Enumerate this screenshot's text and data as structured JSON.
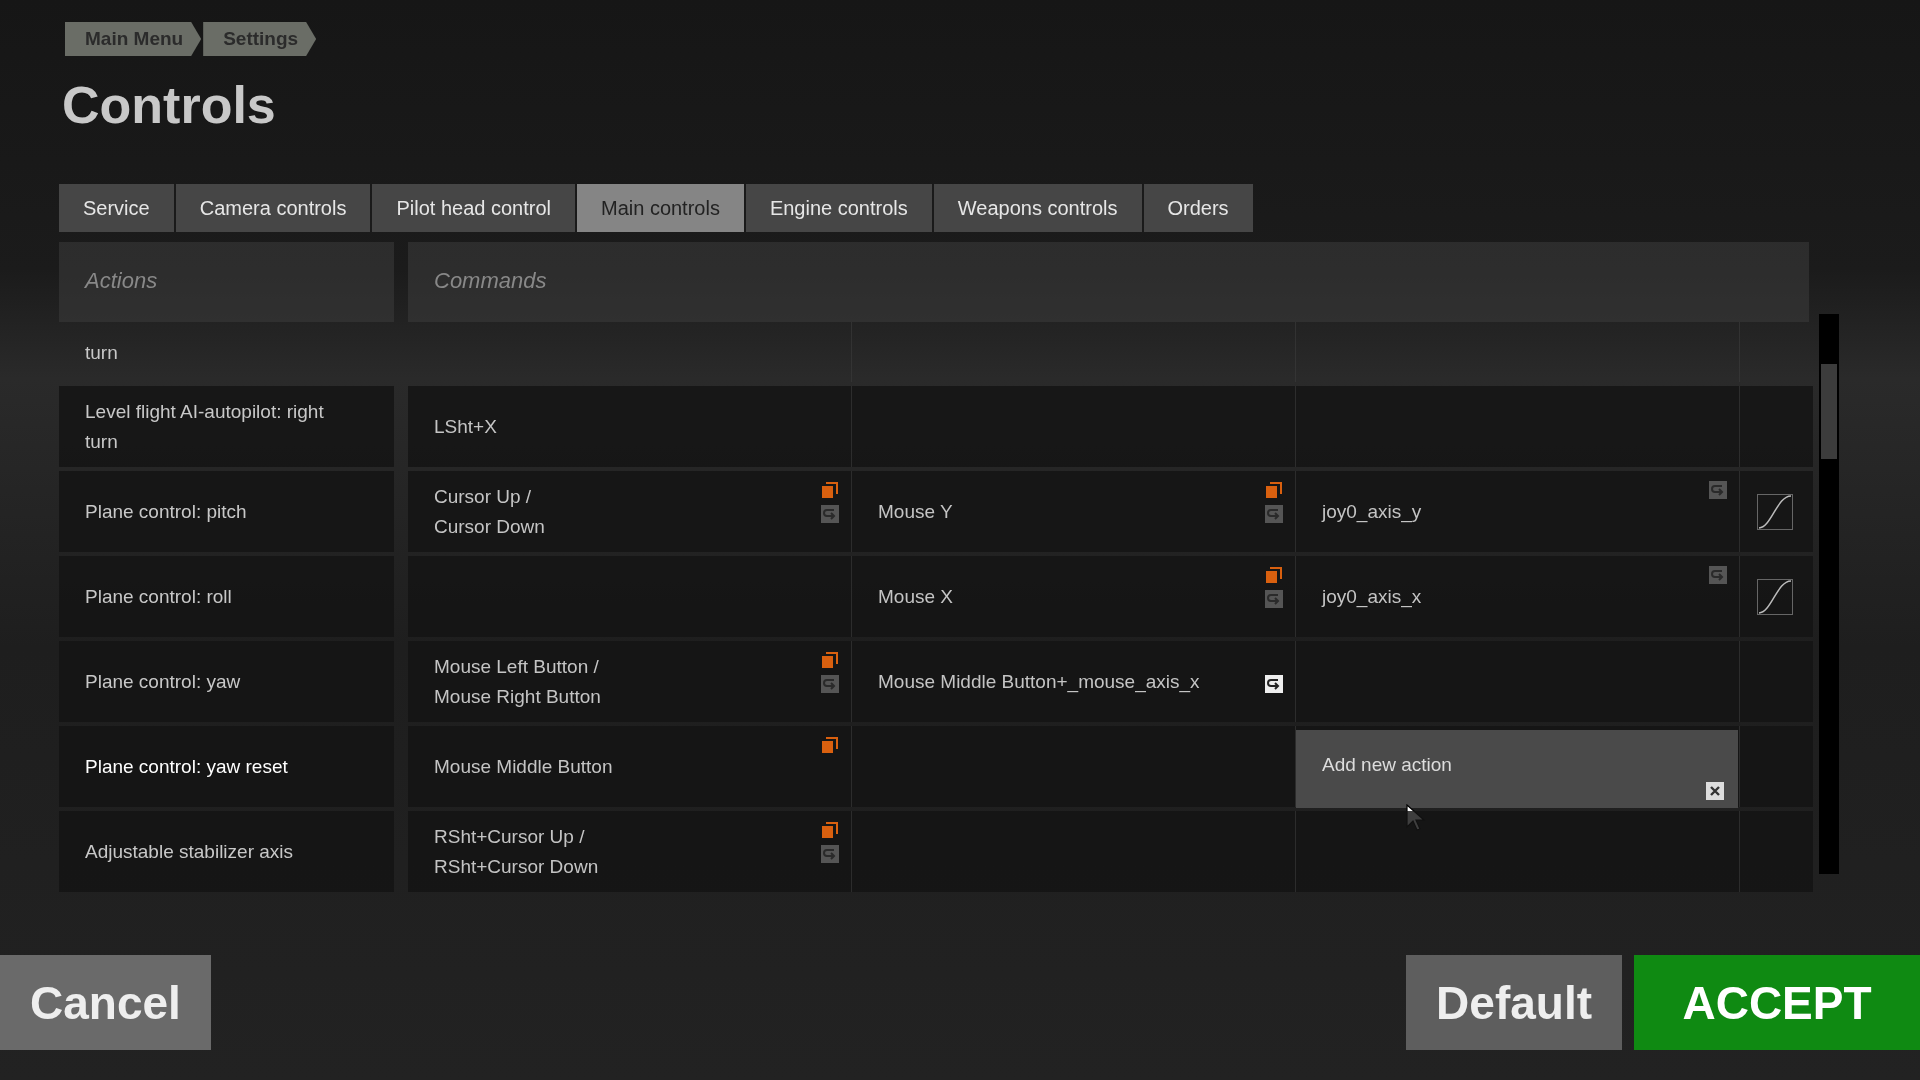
{
  "breadcrumb": [
    "Main Menu",
    "Settings"
  ],
  "title": "Controls",
  "tabs": [
    {
      "label": "Service",
      "selected": false
    },
    {
      "label": "Camera controls",
      "selected": false
    },
    {
      "label": "Pilot head control",
      "selected": false
    },
    {
      "label": "Main controls",
      "selected": true
    },
    {
      "label": "Engine controls",
      "selected": false
    },
    {
      "label": "Weapons controls",
      "selected": false
    },
    {
      "label": "Orders",
      "selected": false
    }
  ],
  "table": {
    "columns": [
      "Actions",
      "Commands"
    ],
    "rows": [
      {
        "action": "turn",
        "selected": false,
        "partial": true
      },
      {
        "action": "Level flight AI-autopilot: right turn",
        "selected": false,
        "column_1": {
          "text": "LSht+X"
        }
      },
      {
        "action": "Plane control: pitch",
        "selected": false,
        "column_1": {
          "text": "Cursor Up /\nCursor Down",
          "copy": true,
          "reset": true
        },
        "column_2": {
          "text": "Mouse Y",
          "copy": true,
          "reset": true
        },
        "column_3": {
          "text": "joy0_axis_y",
          "reset": true,
          "curve": true
        }
      },
      {
        "action": "Plane control: roll",
        "selected": false,
        "column_2": {
          "text": "Mouse X",
          "copy": true,
          "reset": true
        },
        "column_3": {
          "text": "joy0_axis_x",
          "reset": true,
          "curve": true
        }
      },
      {
        "action": "Plane control: yaw",
        "selected": false,
        "column_1": {
          "text": "Mouse Left Button /\nMouse Right Button",
          "copy": true,
          "reset": true
        },
        "column_2": {
          "text": "Mouse Middle Button+_mouse_axis_x",
          "reset": true,
          "reset_active": true
        }
      },
      {
        "action": "Plane control: yaw reset",
        "selected": true,
        "column_1": {
          "text": "Mouse Middle Button",
          "copy": true
        },
        "popup": {
          "label": "Add new action"
        }
      },
      {
        "action": "Adjustable stabilizer axis",
        "selected": false,
        "column_1": {
          "text": "RSht+Cursor Up /\nRSht+Cursor Down",
          "copy": true,
          "reset": true
        }
      }
    ]
  },
  "buttons": [
    {
      "label": "Cancel",
      "kind": "cancel"
    },
    {
      "label": "Default",
      "kind": "default"
    },
    {
      "label": "ACCEPT",
      "kind": "accept"
    }
  ]
}
